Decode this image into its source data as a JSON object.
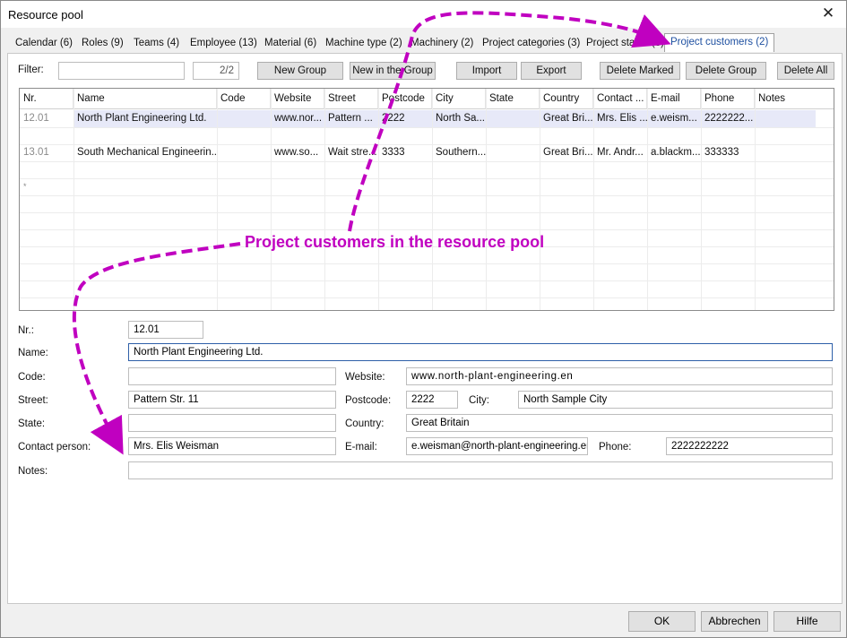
{
  "window": {
    "title": "Resource pool",
    "close_glyph": "✕"
  },
  "tabs": [
    {
      "label": "Calendar (6)"
    },
    {
      "label": "Roles (9)"
    },
    {
      "label": "Teams (4)"
    },
    {
      "label": "Employee (13)"
    },
    {
      "label": "Material (6)"
    },
    {
      "label": "Machine type (2)"
    },
    {
      "label": "Machinery (2)"
    },
    {
      "label": "Project categories (3)"
    },
    {
      "label": "Project status (3)"
    },
    {
      "label": "Project customers (2)",
      "active": true
    }
  ],
  "toolbar": {
    "filter_label": "Filter:",
    "filter_value": "",
    "counter": "2/2",
    "new_group": "New Group",
    "new_in_group": "New in the Group",
    "import": "Import",
    "export": "Export",
    "delete_marked": "Delete Marked",
    "delete_group": "Delete Group",
    "delete_all": "Delete All"
  },
  "table": {
    "columns": [
      "Nr.",
      "Name",
      "Code",
      "Website",
      "Street",
      "Postcode",
      "City",
      "State",
      "Country",
      "Contact ...",
      "E-mail",
      "Phone",
      "Notes"
    ],
    "rows": [
      [
        "12.01",
        "North Plant Engineering Ltd.",
        "",
        "www.nor...",
        "Pattern ...",
        "2222",
        "North Sa...",
        "",
        "Great Bri...",
        "Mrs. Elis ...",
        "e.weism...",
        "2222222...",
        ""
      ],
      [
        "13.01",
        "South Mechanical Engineerin...",
        "",
        "www.so...",
        "Wait stre...",
        "3333",
        "Southern...",
        "",
        "Great Bri...",
        "Mr. Andr...",
        "a.blackm...",
        "333333",
        ""
      ]
    ],
    "new_row_marker": "*"
  },
  "annotation": {
    "text": "Project customers in the resource pool",
    "color": "#c000c0"
  },
  "form": {
    "nr_label": "Nr.:",
    "nr_value": "12.01",
    "name_label": "Name:",
    "name_value": "North Plant Engineering Ltd.",
    "code_label": "Code:",
    "code_value": "",
    "website_label": "Website:",
    "website_value": "www.north-plant-engineering.en",
    "street_label": "Street:",
    "street_value": "Pattern Str. 11",
    "postcode_label": "Postcode:",
    "postcode_value": "2222",
    "city_label": "City:",
    "city_value": "North Sample City",
    "state_label": "State:",
    "state_value": "",
    "country_label": "Country:",
    "country_value": "Great Britain",
    "contact_label": "Contact person:",
    "contact_value": "Mrs. Elis Weisman",
    "email_label": "E-mail:",
    "email_value": "e.weisman@north-plant-engineering.en",
    "phone_label": "Phone:",
    "phone_value": "2222222222",
    "notes_label": "Notes:",
    "notes_value": ""
  },
  "footer": {
    "ok": "OK",
    "cancel": "Abbrechen",
    "help": "Hilfe"
  }
}
